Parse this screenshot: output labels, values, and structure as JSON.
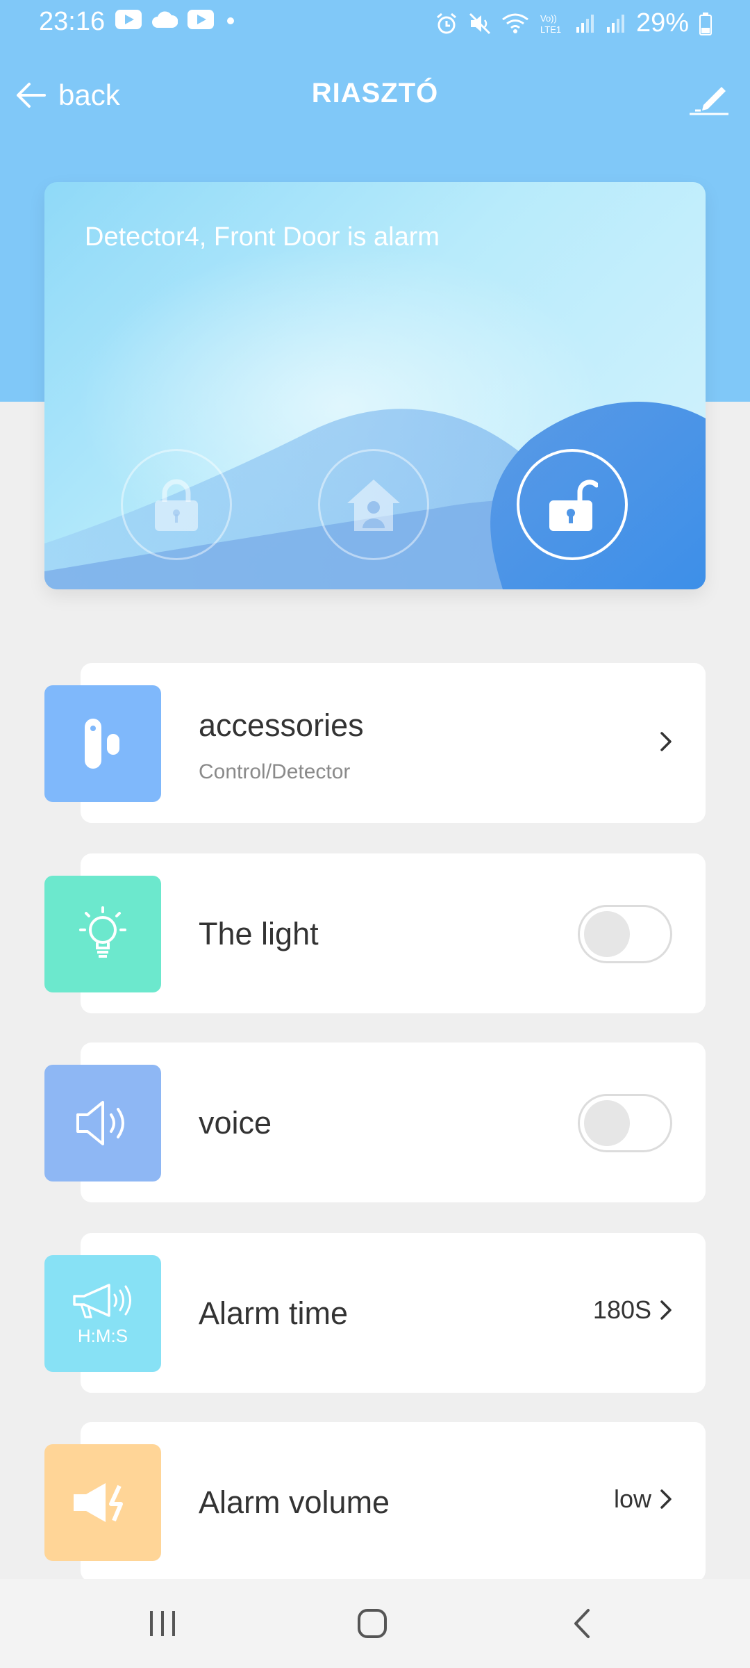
{
  "status_bar": {
    "time": "23:16",
    "left_icons": [
      "youtube-icon",
      "cloud-icon",
      "youtube-icon",
      "dot-icon"
    ],
    "right_icons": [
      "alarm-clock-icon",
      "mute-icon",
      "wifi-icon",
      "volte-icon",
      "signal-icon",
      "signal-icon",
      "battery-icon"
    ],
    "battery": "29%"
  },
  "header": {
    "back_label": "back",
    "title": "RIASZTÓ",
    "edit_icon": "edit-icon"
  },
  "alarm_card": {
    "status_text": "Detector4, Front Door is alarm",
    "modes": [
      {
        "name": "arm",
        "icon": "lock-icon",
        "active": false
      },
      {
        "name": "home",
        "icon": "home-icon",
        "active": false
      },
      {
        "name": "disarm",
        "icon": "unlock-icon",
        "active": true
      }
    ]
  },
  "settings": {
    "accessories": {
      "label": "accessories",
      "sublabel": "Control/Detector",
      "icon": "detector-icon",
      "color": "#7fb8fb"
    },
    "light": {
      "label": "The light",
      "icon": "light-bulb-icon",
      "color": "#6ce8cd",
      "on": false
    },
    "voice": {
      "label": "voice",
      "icon": "speaker-icon",
      "color": "#8eb7f4",
      "on": false
    },
    "alarm_time": {
      "label": "Alarm time",
      "value": "180S",
      "icon_caption": "H:M:S",
      "icon": "megaphone-icon",
      "color": "#87e1f5"
    },
    "alarm_volume": {
      "label": "Alarm volume",
      "value": "low",
      "icon": "volume-alert-icon",
      "color": "#ffd597"
    }
  },
  "colors": {
    "header_blue": "#80c8f8",
    "background": "#efefef"
  }
}
